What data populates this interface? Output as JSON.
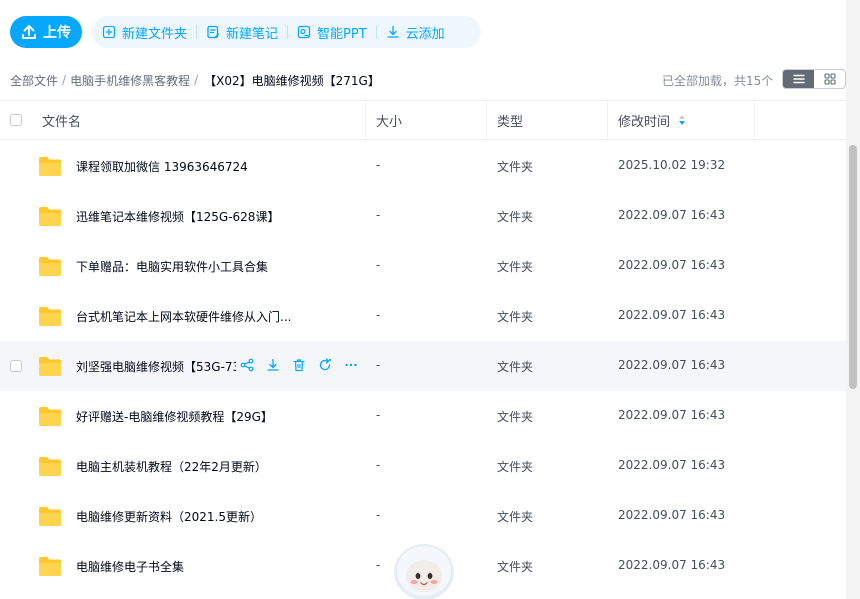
{
  "toolbar": {
    "upload_label": "上传",
    "actions": [
      {
        "label": "新建文件夹",
        "icon": "new-folder-icon"
      },
      {
        "label": "新建笔记",
        "icon": "note-icon"
      },
      {
        "label": "智能PPT",
        "icon": "ppt-icon"
      },
      {
        "label": "云添加",
        "icon": "download-icon"
      }
    ]
  },
  "breadcrumb": {
    "items": [
      "全部文件",
      "电脑手机维修黑客教程"
    ],
    "current": "【X02】电脑维修视频【271G】"
  },
  "status": {
    "loaded_text": "已全部加载，共15个"
  },
  "view": {
    "mode": "list"
  },
  "table": {
    "columns": {
      "name": "文件名",
      "size": "大小",
      "type": "类型",
      "modified": "修改时间"
    },
    "sort": {
      "column": "modified"
    },
    "rows": [
      {
        "name": "课程领取加微信 13963646724",
        "size": "-",
        "type": "文件夹",
        "modified": "2025.10.02 19:32"
      },
      {
        "name": "迅维笔记本维修视频【125G-628课】",
        "size": "-",
        "type": "文件夹",
        "modified": "2022.09.07 16:43"
      },
      {
        "name": "下单赠品：电脑实用软件小工具合集",
        "size": "-",
        "type": "文件夹",
        "modified": "2022.09.07 16:43"
      },
      {
        "name": "台式机笔记本上网本软硬件维修从入门...",
        "size": "-",
        "type": "文件夹",
        "modified": "2022.09.07 16:43"
      },
      {
        "name": "刘坚强电脑维修视频【53G-73",
        "size": "-",
        "type": "文件夹",
        "modified": "2022.09.07 16:43",
        "hovered": true
      },
      {
        "name": "好评赠送-电脑维修视频教程【29G】",
        "size": "-",
        "type": "文件夹",
        "modified": "2022.09.07 16:43"
      },
      {
        "name": "电脑主机装机教程（22年2月更新）",
        "size": "-",
        "type": "文件夹",
        "modified": "2022.09.07 16:43"
      },
      {
        "name": "电脑维修更新资料（2021.5更新）",
        "size": "-",
        "type": "文件夹",
        "modified": "2022.09.07 16:43"
      },
      {
        "name": "电脑维修电子书全集",
        "size": "-",
        "type": "文件夹",
        "modified": "2022.09.07 16:43"
      }
    ]
  },
  "colors": {
    "accent": "#06a7ff",
    "folder": "#ffc72c",
    "hover_row": "#f5f6f9"
  }
}
